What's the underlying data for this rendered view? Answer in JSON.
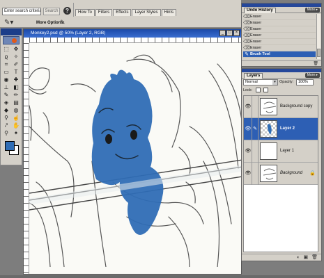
{
  "options_bar": {
    "search_placeholder": "Enter search criteria",
    "search_button": "Search",
    "more_options_label": "More Options:",
    "palette_well_tabs": [
      "How To",
      "Filters",
      "Effects",
      "Layer Styles",
      "Hints"
    ]
  },
  "document": {
    "title": "Monkey2.psd @ 50% (Layer 2, RGB)"
  },
  "undo_history": {
    "tab_label": "Undo History",
    "more_label": "More ▸",
    "items": [
      {
        "label": "Eraser"
      },
      {
        "label": "Eraser"
      },
      {
        "label": "Eraser"
      },
      {
        "label": "Eraser"
      },
      {
        "label": "Eraser"
      },
      {
        "label": "Eraser"
      },
      {
        "label": "Brush Tool"
      }
    ],
    "selected_index": 6
  },
  "layers": {
    "tab_label": "Layers",
    "more_label": "More ▸",
    "blend_mode": "Normal",
    "opacity_label": "Opacity:",
    "opacity_value": "100%",
    "lock_label": "Lock:",
    "items": [
      {
        "name": "Background copy"
      },
      {
        "name": "Layer 2"
      },
      {
        "name": "Layer 1"
      },
      {
        "name": "Background"
      }
    ],
    "selected_index": 1
  },
  "colors": {
    "foreground": "#2f6db5",
    "background": "#ffffff",
    "selection": "#2d5fb4"
  }
}
